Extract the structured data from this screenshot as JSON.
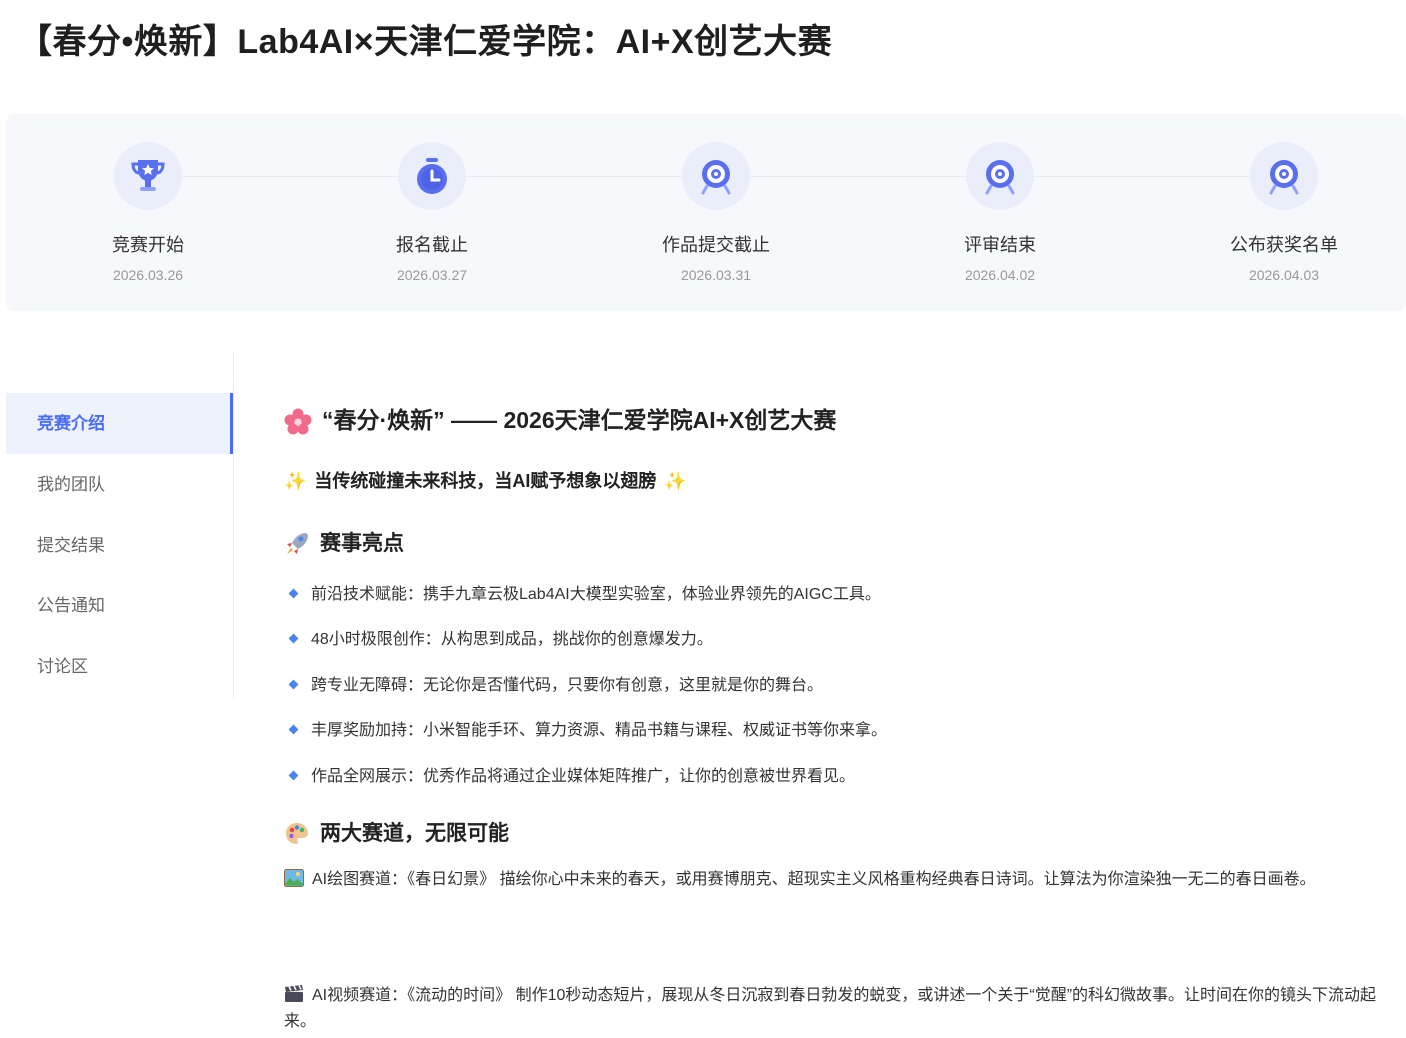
{
  "title": "【春分•焕新】Lab4AI×天津仁爱学院：AI+X创艺大赛",
  "timeline": [
    {
      "label": "竞赛开始",
      "date": "2026.03.26",
      "icon": "trophy-icon"
    },
    {
      "label": "报名截止",
      "date": "2026.03.27",
      "icon": "stopwatch-icon"
    },
    {
      "label": "作品提交截止",
      "date": "2026.03.31",
      "icon": "target-icon"
    },
    {
      "label": "评审结束",
      "date": "2026.04.02",
      "icon": "target-icon"
    },
    {
      "label": "公布获奖名单",
      "date": "2026.04.03",
      "icon": "target-icon"
    }
  ],
  "sidebar": {
    "active": "竞赛介绍",
    "items": [
      {
        "label": "竞赛介绍"
      },
      {
        "label": "我的团队"
      },
      {
        "label": "提交结果"
      },
      {
        "label": "公告通知"
      },
      {
        "label": "讨论区"
      }
    ]
  },
  "content": {
    "heading": "“春分·焕新” —— 2026天津仁爱学院AI+X创艺大赛",
    "slogan": "当传统碰撞未来科技，当AI赋予想象以翅膀",
    "highlights_title": "赛事亮点",
    "highlights": [
      "前沿技术赋能：携手九章云极Lab4AI大模型实验室，体验业界领先的AIGC工具。",
      "48小时极限创作：从构思到成品，挑战你的创意爆发力。",
      "跨专业无障碍：无论你是否懂代码，只要你有创意，这里就是你的舞台。",
      "丰厚奖励加持：小米智能手环、算力资源、精品书籍与课程、权威证书等你来拿。",
      "作品全网展示：优秀作品将通过企业媒体矩阵推广，让你的创意被世界看见。"
    ],
    "tracks_title": "两大赛道，无限可能",
    "tracks": [
      {
        "icon": "picture-icon",
        "text": "AI绘图赛道：《春日幻景》 描绘你心中未来的春天，或用赛博朋克、超现实主义风格重构经典春日诗词。让算法为你渲染独一无二的春日画卷。"
      },
      {
        "icon": "clapper-icon",
        "text": "AI视频赛道：《流动的时间》 制作10秒动态短片，展现从冬日沉寂到春日勃发的蜕变，或讲述一个关于“觉醒”的科幻微故事。让时间在你的镜头下流动起来。"
      }
    ]
  }
}
